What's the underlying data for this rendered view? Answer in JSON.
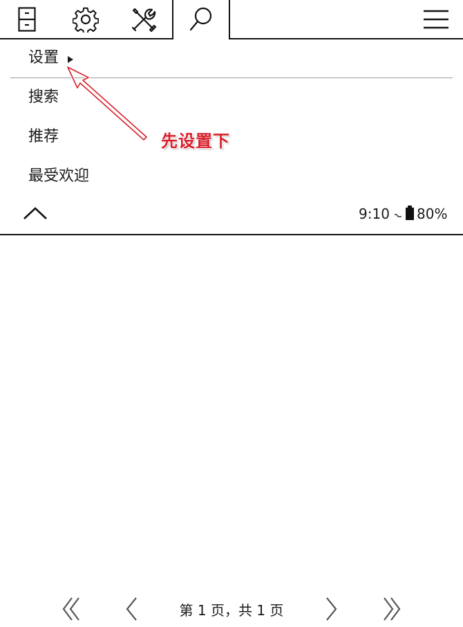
{
  "toolbar": {
    "icons": [
      "library-icon",
      "gear-icon",
      "tools-icon",
      "search-icon",
      "menu-icon"
    ],
    "active_tab": "search-icon"
  },
  "menu": {
    "items": [
      {
        "label": "设置",
        "has_submenu": true
      },
      {
        "label": "搜索"
      },
      {
        "label": "推荐"
      },
      {
        "label": "最受欢迎"
      }
    ]
  },
  "annotation": {
    "text": "先设置下",
    "color": "#d81f2a"
  },
  "status": {
    "time": "9:10",
    "battery": "80%"
  },
  "pager": {
    "label": "第 1 页，共 1 页"
  }
}
